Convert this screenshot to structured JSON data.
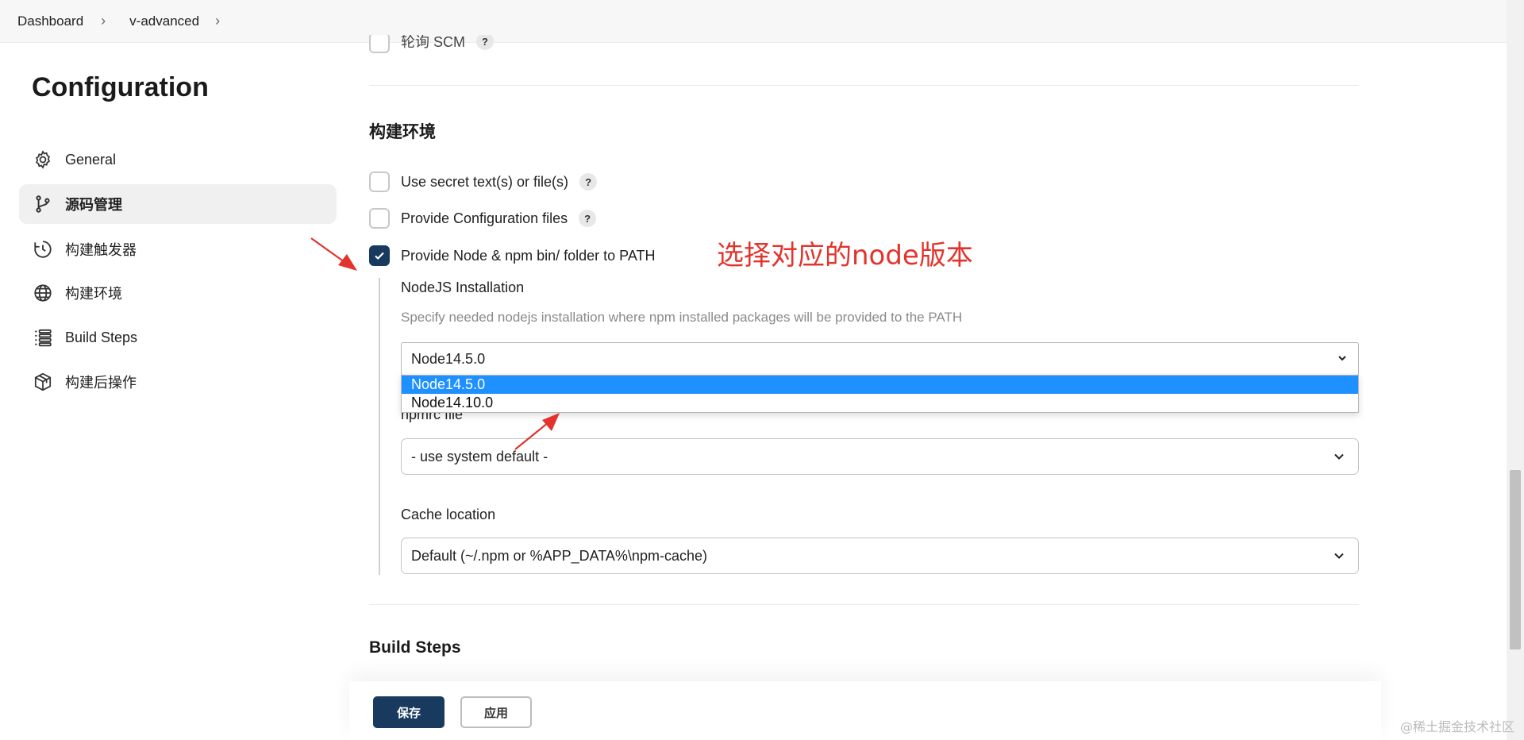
{
  "breadcrumb": {
    "items": [
      "Dashboard",
      "v-advanced"
    ]
  },
  "sidebar": {
    "title": "Configuration",
    "items": [
      {
        "label": "General",
        "icon": "gear-icon"
      },
      {
        "label": "源码管理",
        "icon": "git-branch-icon",
        "active": true
      },
      {
        "label": "构建触发器",
        "icon": "clock-icon"
      },
      {
        "label": "构建环境",
        "icon": "globe-icon"
      },
      {
        "label": "Build Steps",
        "icon": "list-icon"
      },
      {
        "label": "构建后操作",
        "icon": "cube-icon"
      }
    ]
  },
  "main": {
    "partial_option": {
      "label": "轮询 SCM"
    },
    "build_env": {
      "title": "构建环境",
      "options": [
        {
          "label": "Use secret text(s) or file(s)",
          "checked": false
        },
        {
          "label": "Provide Configuration files",
          "checked": false
        },
        {
          "label": "Provide Node & npm bin/ folder to PATH",
          "checked": true
        }
      ],
      "nodejs": {
        "label": "NodeJS Installation",
        "description": "Specify needed nodejs installation where npm installed packages will be provided to the PATH",
        "selected": "Node14.5.0",
        "options": [
          "Node14.5.0",
          "Node14.10.0"
        ]
      },
      "npmrc": {
        "label": "npmrc file",
        "value": "- use system default -"
      },
      "cache": {
        "label": "Cache location",
        "value": "Default (~/.npm or %APP_DATA%\\npm-cache)"
      }
    },
    "build_steps": {
      "title": "Build Steps"
    }
  },
  "annotation": {
    "text": "选择对应的node版本",
    "color": "#e4332d"
  },
  "actions": {
    "save": "保存",
    "apply": "应用"
  },
  "help_symbol": "?",
  "watermark": "@稀土掘金技术社区",
  "colors": {
    "primary": "#173a5e",
    "selected_option": "#1e90ff",
    "annotation": "#e4332d"
  }
}
